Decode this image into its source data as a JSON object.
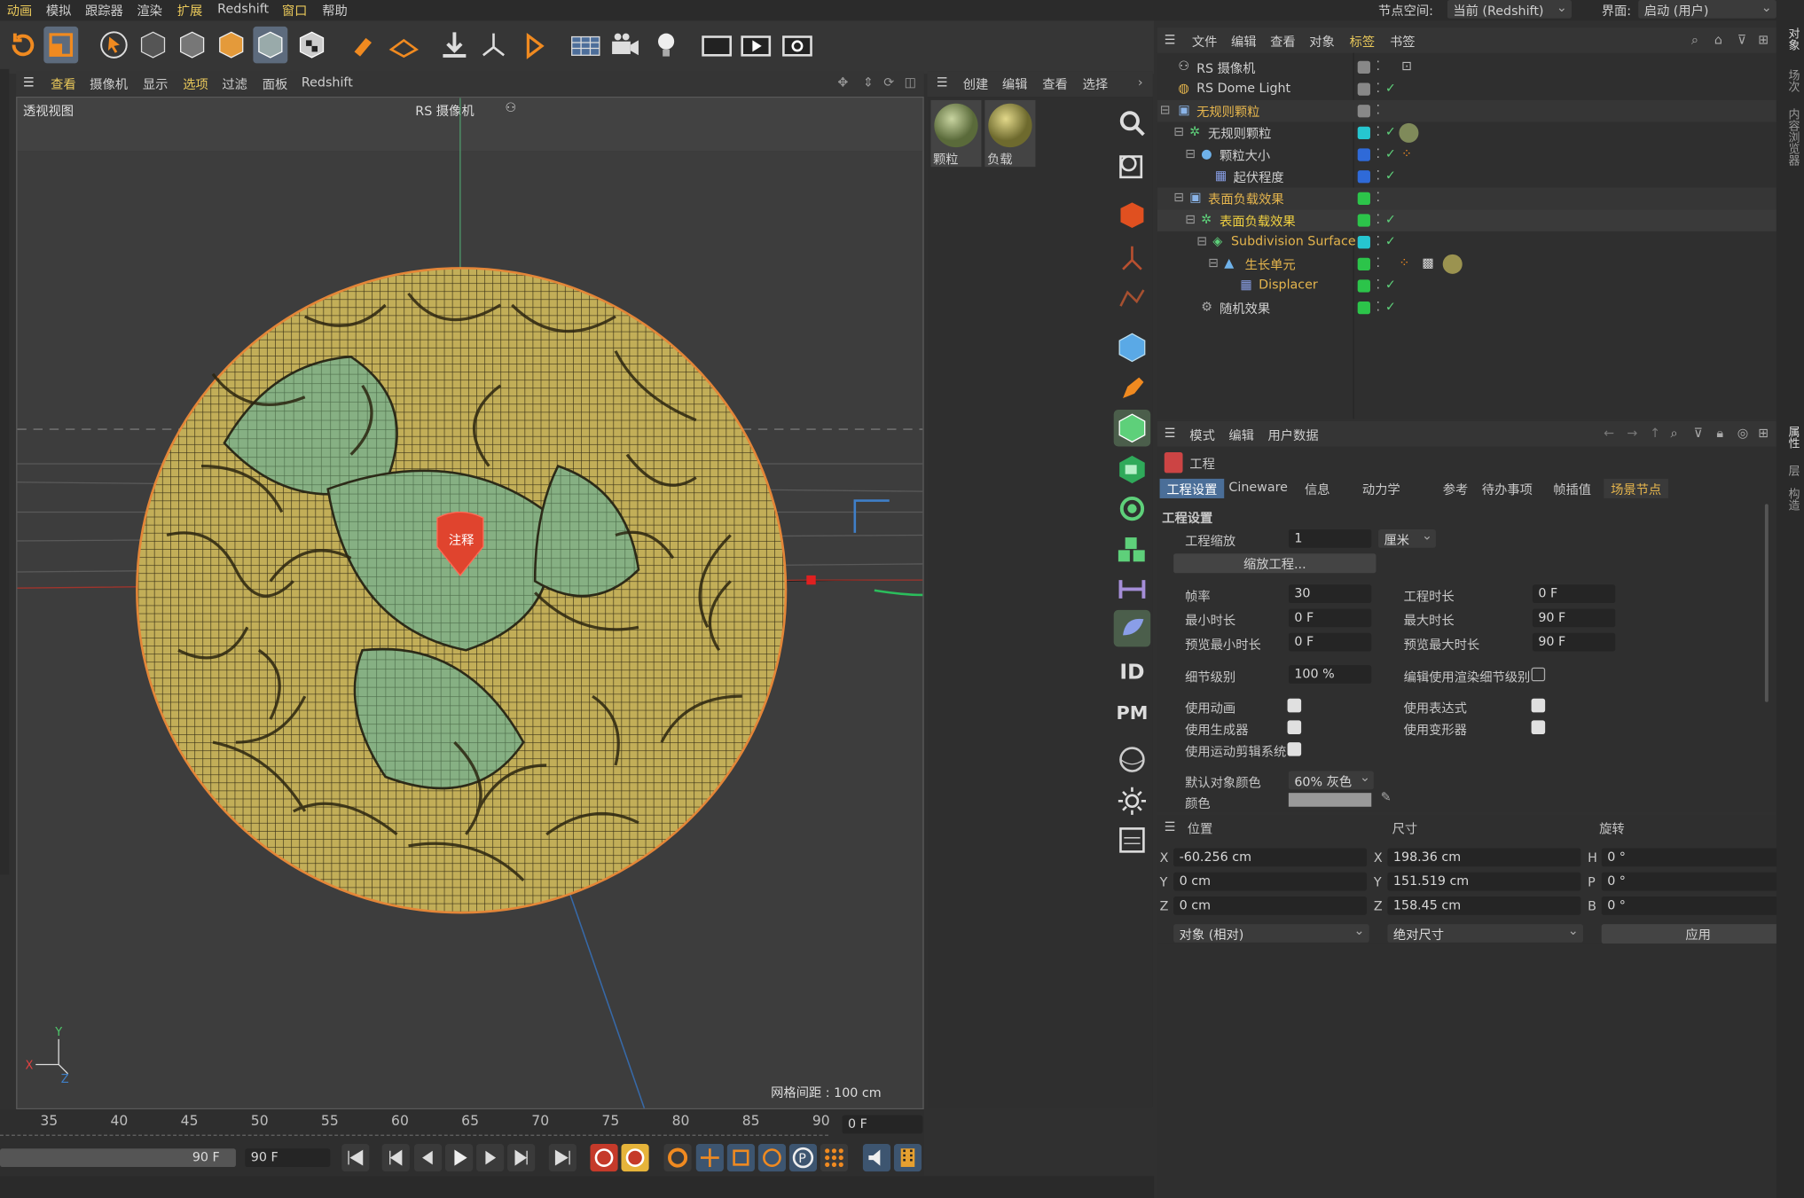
{
  "menu": {
    "items": [
      "动画",
      "模拟",
      "跟踪器",
      "渲染",
      "扩展",
      "Redshift",
      "窗口",
      "帮助"
    ],
    "node_space_label": "节点空间:",
    "node_space_value": "当前 (Redshift)",
    "layout_label": "界面:",
    "layout_value": "启动 (用户)"
  },
  "viewport": {
    "menu": [
      "查看",
      "摄像机",
      "显示",
      "选项",
      "过滤",
      "面板",
      "Redshift"
    ],
    "name": "透视视图",
    "camera": "RS 摄像机",
    "annotation": "注释",
    "grid_spacing": "网格间距 : 100 cm",
    "axis_x": "X",
    "axis_y": "Y",
    "axis_z": "Z"
  },
  "timeline": {
    "ticks": [
      "35",
      "40",
      "45",
      "50",
      "55",
      "60",
      "65",
      "70",
      "75",
      "80",
      "85",
      "90"
    ],
    "current_frame": "0 F",
    "end_frame_a": "90 F",
    "end_frame_b": "90 F"
  },
  "materials": {
    "menu": [
      "创建",
      "编辑",
      "查看",
      "选择"
    ],
    "items": [
      {
        "name": "颗粒",
        "color": "#8e9a6a"
      },
      {
        "name": "负载",
        "color": "#a7a05a"
      }
    ]
  },
  "object_manager": {
    "menu": [
      "文件",
      "编辑",
      "查看",
      "对象",
      "标签",
      "书签"
    ],
    "objects": [
      {
        "name": "RS 摄像机",
        "indent": 0,
        "color": "#dcdcdc"
      },
      {
        "name": "RS Dome Light",
        "indent": 0,
        "color": "#dcdcdc"
      },
      {
        "name": "无规则颗粒",
        "indent": 0,
        "color": "#e5b54d"
      },
      {
        "name": "无规则颗粒",
        "indent": 1,
        "color": "#dcdcdc"
      },
      {
        "name": "颗粒大小",
        "indent": 2,
        "color": "#dcdcdc"
      },
      {
        "name": "起伏程度",
        "indent": 3,
        "color": "#dcdcdc"
      },
      {
        "name": "表面负载效果",
        "indent": 1,
        "color": "#e5b54d"
      },
      {
        "name": "表面负载效果",
        "indent": 2,
        "color": "#f0d040"
      },
      {
        "name": "Subdivision Surface",
        "indent": 3,
        "color": "#e5b54d"
      },
      {
        "name": "生长单元",
        "indent": 4,
        "color": "#e5b54d"
      },
      {
        "name": "Displacer",
        "indent": 5,
        "color": "#e5b54d"
      },
      {
        "name": "随机效果",
        "indent": 2,
        "color": "#dcdcdc"
      }
    ]
  },
  "attributes": {
    "menu": [
      "模式",
      "编辑",
      "用户数据"
    ],
    "title": "工程",
    "tabs": [
      "工程设置",
      "Cineware",
      "信息",
      "动力学",
      "参考",
      "待办事项",
      "帧插值",
      "场景节点"
    ],
    "section": "工程设置",
    "project_scale_label": "工程缩放",
    "project_scale_value": "1",
    "project_scale_unit": "厘米",
    "scale_button": "缩放工程...",
    "fps_label": "帧率",
    "fps_value": "30",
    "project_length_label": "工程时长",
    "project_length_value": "0 F",
    "min_time_label": "最小时长",
    "min_time_value": "0 F",
    "max_time_label": "最大时长",
    "max_time_value": "90 F",
    "preview_min_label": "预览最小时长",
    "preview_min_value": "0 F",
    "preview_max_label": "预览最大时长",
    "preview_max_value": "90 F",
    "lod_label": "细节级别",
    "lod_value": "100 %",
    "render_lod_label": "编辑使用渲染细节级别",
    "use_animation_label": "使用动画",
    "use_expressions_label": "使用表达式",
    "use_generators_label": "使用生成器",
    "use_deformers_label": "使用变形器",
    "use_motion_label": "使用运动剪辑系统",
    "default_color_label": "默认对象颜色",
    "default_color_value": "60% 灰色",
    "color_label": "颜色"
  },
  "coordinates": {
    "headers": [
      "位置",
      "尺寸",
      "旋转"
    ],
    "pos_x": "-60.256 cm",
    "pos_y": "0 cm",
    "pos_z": "0 cm",
    "size_x": "198.36 cm",
    "size_y": "151.519 cm",
    "size_z": "158.45 cm",
    "rot_h": "0 °",
    "rot_p": "0 °",
    "rot_b": "0 °",
    "axis_labels": [
      "X",
      "Y",
      "Z"
    ],
    "rot_labels": [
      "H",
      "P",
      "B"
    ],
    "mode": "对象 (相对)",
    "size_mode": "绝对尺寸",
    "apply": "应用"
  },
  "right_side_tabs": [
    "对象",
    "场次",
    "内容浏览器",
    "属性",
    "层",
    "构造"
  ]
}
